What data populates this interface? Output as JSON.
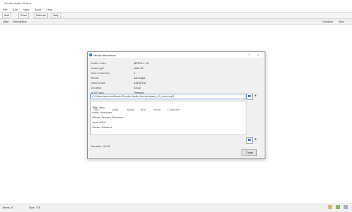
{
  "app": {
    "title": "Gumbo Audio Archive"
  },
  "menus": [
    "File",
    "Edit",
    "View",
    "Tools",
    "Help"
  ],
  "toolbar": {
    "buttons": [
      "Add",
      "Scan",
      "Refresh",
      "Help"
    ]
  },
  "table": {
    "col1": "Date",
    "col2": "Description",
    "col3": "Duration",
    "col4": "Size"
  },
  "modal": {
    "title": "Media information",
    "help": "?",
    "close": "x",
    "fields": [
      {
        "label": "Audio codec",
        "value": "MPEG-1 L3"
      },
      {
        "label": "Audio type",
        "value": "Joint St."
      },
      {
        "label": "Num Channels",
        "value": "2"
      },
      {
        "label": "Bitrate",
        "value": "320 kbps"
      },
      {
        "label": "Samplerate",
        "value": "44100 Hz"
      },
      {
        "label": "Duration",
        "value": "03:42"
      },
      {
        "label": "Id3v2 tags",
        "value": "Present"
      }
    ],
    "path_label": "Path",
    "path_value": "C:\\Users\\archive\\Music\\Gumbo Audio Archive\\track_01_intro.mp3",
    "list_label": "Tags",
    "list_rows": [
      "Title: Intro",
      "Artist: Unknown",
      "Album: Archive Sessions",
      "Year: 2019",
      "Genre: Ambient"
    ],
    "hidden_row_items": [
      "Title",
      "Artist",
      "Album",
      "Year",
      "Genre",
      "Comment"
    ],
    "footer": "Duration: 03:42",
    "close_button": "Close"
  },
  "status": {
    "left": "Items: 0",
    "right": "Size: 0 B"
  }
}
